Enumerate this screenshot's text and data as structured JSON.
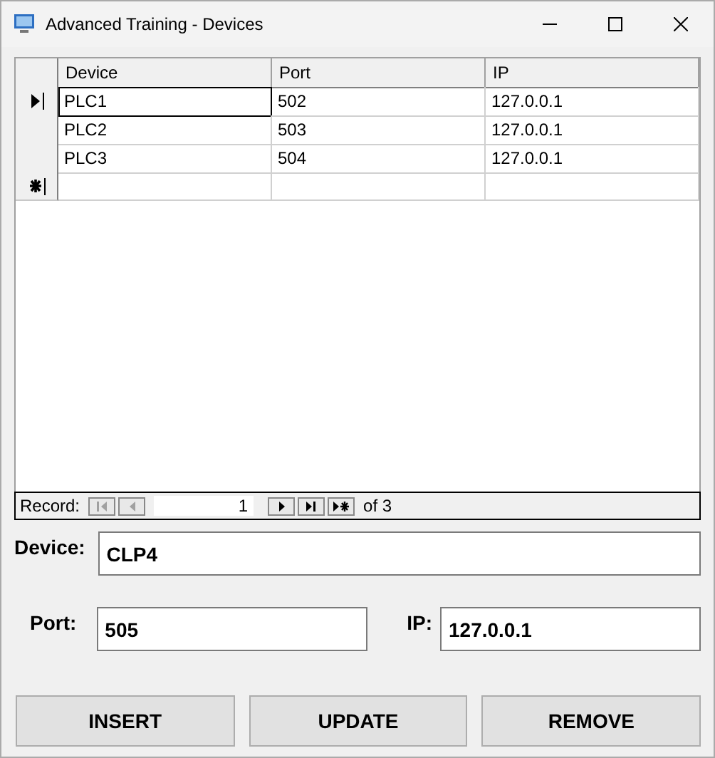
{
  "window": {
    "title": "Advanced Training - Devices"
  },
  "table": {
    "columns": [
      "Device",
      "Port",
      "IP"
    ],
    "rows": [
      {
        "cells": [
          "PLC1",
          "502",
          "127.0.0.1"
        ],
        "selected": true
      },
      {
        "cells": [
          "PLC2",
          "503",
          "127.0.0.1"
        ],
        "selected": false
      },
      {
        "cells": [
          "PLC3",
          "504",
          "127.0.0.1"
        ],
        "selected": false
      }
    ]
  },
  "navigator": {
    "label": "Record:",
    "value": "1",
    "total": "of 3",
    "buttons": [
      {
        "kind": "first",
        "disabled": true
      },
      {
        "kind": "prev",
        "disabled": true
      },
      {
        "kind": "next",
        "disabled": false
      },
      {
        "kind": "last",
        "disabled": false
      },
      {
        "kind": "new",
        "disabled": false
      }
    ]
  },
  "form": {
    "device": {
      "label": "Device:",
      "value": "CLP4"
    },
    "port": {
      "label": "Port:",
      "value": "505"
    },
    "ip": {
      "label": "IP:",
      "value": "127.0.0.1"
    }
  },
  "buttons": [
    "INSERT",
    "UPDATE",
    "REMOVE"
  ]
}
